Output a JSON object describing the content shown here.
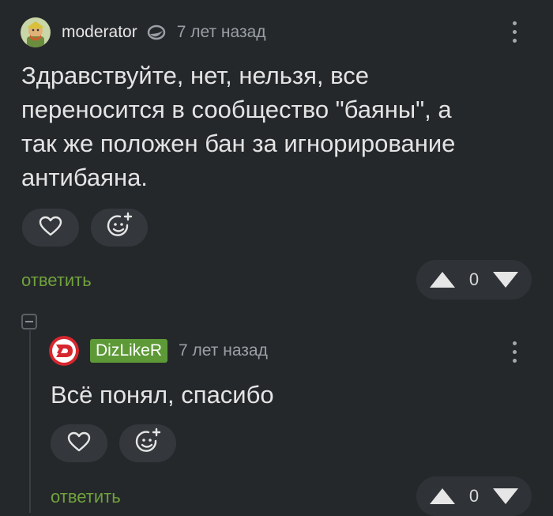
{
  "comments": [
    {
      "username": "moderator",
      "time": "7 лет назад",
      "text": "Здравствуйте, нет, нельзя, все переносится в сообщество \"баяны\", а так же положен бан за игнорирование антибаяна.",
      "reply_label": "ответить",
      "rating": "0"
    },
    {
      "username": "DizLikeR",
      "time": "7 лет назад",
      "text": "Всё понял, спасибо",
      "reply_label": "ответить",
      "rating": "0"
    }
  ],
  "icons": {
    "like": "heart-icon",
    "react": "add-emoji-icon",
    "upvote": "triangle-up-icon",
    "downvote": "triangle-down-icon",
    "menu": "more-vertical-icon",
    "collapse": "collapse-thread-icon",
    "moderator_badge": "moderator-shield-icon"
  },
  "colors": {
    "background": "#25282b",
    "reply_green": "#6fa23d",
    "username_badge": "#5d9a37",
    "text": "#e4e4e4",
    "muted": "#9aa0a6"
  }
}
